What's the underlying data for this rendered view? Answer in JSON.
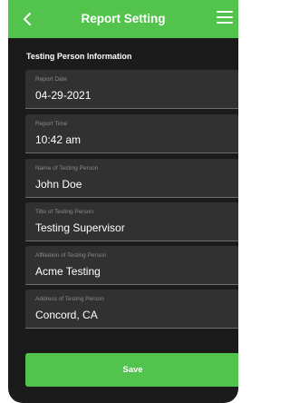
{
  "header": {
    "title": "Report Setting",
    "back_icon": "chevron-left-icon",
    "menu_icon": "hamburger-menu-icon",
    "accent_color": "#52c34c"
  },
  "section": {
    "title": "Testing Person Information"
  },
  "fields": [
    {
      "label": "Report Date",
      "value": "04-29-2021"
    },
    {
      "label": "Report Time",
      "value": "10:42 am"
    },
    {
      "label": "Name of Testing Person",
      "value": "John Doe"
    },
    {
      "label": "Title of Testing Person",
      "value": "Testing Supervisor"
    },
    {
      "label": "Affiliation of Testing Person",
      "value": "Acme Testing"
    },
    {
      "label": "Address of Testing Person",
      "value": "Concord, CA"
    }
  ],
  "actions": {
    "save_label": "Save"
  }
}
